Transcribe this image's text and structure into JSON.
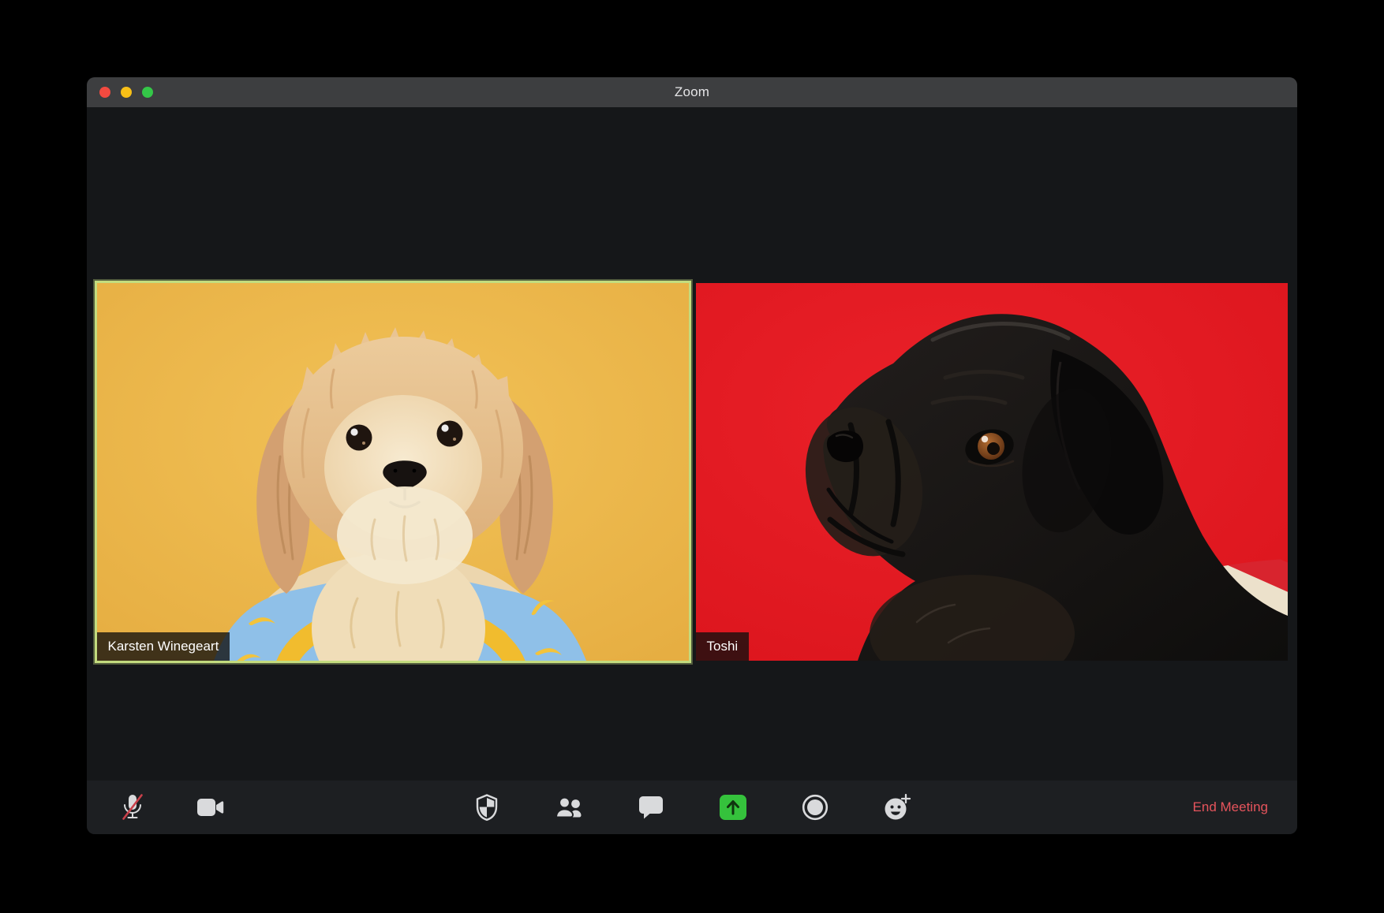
{
  "window": {
    "title": "Zoom",
    "traffic_lights": [
      "close",
      "minimize",
      "zoom"
    ]
  },
  "participants": [
    {
      "name": "Karsten Winegeart",
      "active_speaker": true,
      "tile_background": "#ecb84f",
      "subject": "cream fluffy dog in blue banana shirt"
    },
    {
      "name": "Toshi",
      "active_speaker": false,
      "tile_background": "#e11c24",
      "subject": "black pug in striped sweater"
    }
  ],
  "toolbar": {
    "buttons": [
      {
        "id": "mute",
        "icon": "microphone-muted-icon",
        "state": "muted"
      },
      {
        "id": "video",
        "icon": "video-camera-icon",
        "state": "on"
      },
      {
        "id": "security",
        "icon": "shield-icon"
      },
      {
        "id": "participants",
        "icon": "participants-icon"
      },
      {
        "id": "chat",
        "icon": "chat-bubble-icon"
      },
      {
        "id": "share-screen",
        "icon": "share-screen-icon",
        "accent_color": "#35c23c"
      },
      {
        "id": "record",
        "icon": "record-icon"
      },
      {
        "id": "reactions",
        "icon": "reactions-smiley-icon"
      }
    ],
    "end_meeting_label": "End Meeting"
  },
  "colors": {
    "active_speaker_border": "#c3dc7e",
    "mute_slash_red": "#c9404a",
    "share_green": "#35c23c",
    "end_meeting_red": "#e6545c",
    "titlebar_bg": "#3d3e40",
    "toolbar_bg": "#1d1f22",
    "content_bg": "#151719"
  }
}
